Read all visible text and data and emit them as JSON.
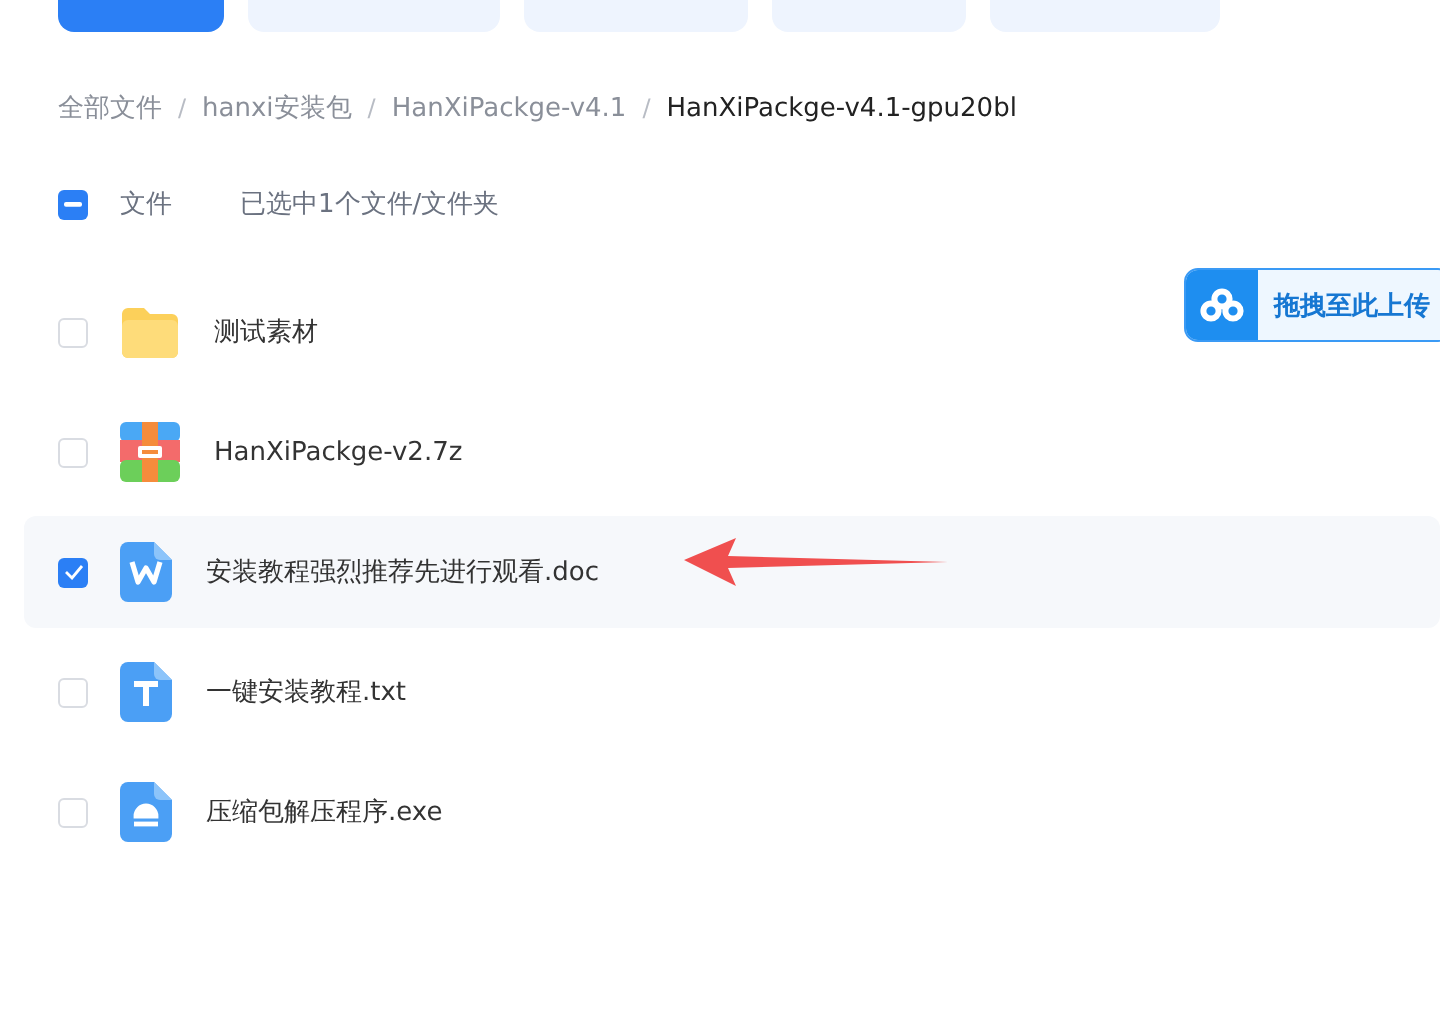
{
  "toolbar": [
    {
      "kind": "primary"
    },
    {
      "kind": "secondary"
    },
    {
      "kind": "secondary"
    },
    {
      "kind": "secondary"
    },
    {
      "kind": "secondary"
    }
  ],
  "breadcrumb": {
    "separator": "/",
    "items": [
      "全部文件",
      "hanxi安装包",
      "HanXiPackge-v4.1",
      "HanXiPackge-v4.1-gpu20bl"
    ]
  },
  "header": {
    "label": "文件",
    "status": "已选中1个文件/文件夹",
    "indeterminate": true
  },
  "files": [
    {
      "name": "测试素材",
      "kind": "folder",
      "selected": false
    },
    {
      "name": "HanXiPackge-v2.7z",
      "kind": "archive",
      "selected": false
    },
    {
      "name": "安装教程强烈推荐先进行观看.doc",
      "kind": "doc",
      "selected": true
    },
    {
      "name": "一键安装教程.txt",
      "kind": "txt",
      "selected": false
    },
    {
      "name": "压缩包解压程序.exe",
      "kind": "exe",
      "selected": false
    }
  ],
  "drop_badge": {
    "label": "拖拽至此上传"
  }
}
